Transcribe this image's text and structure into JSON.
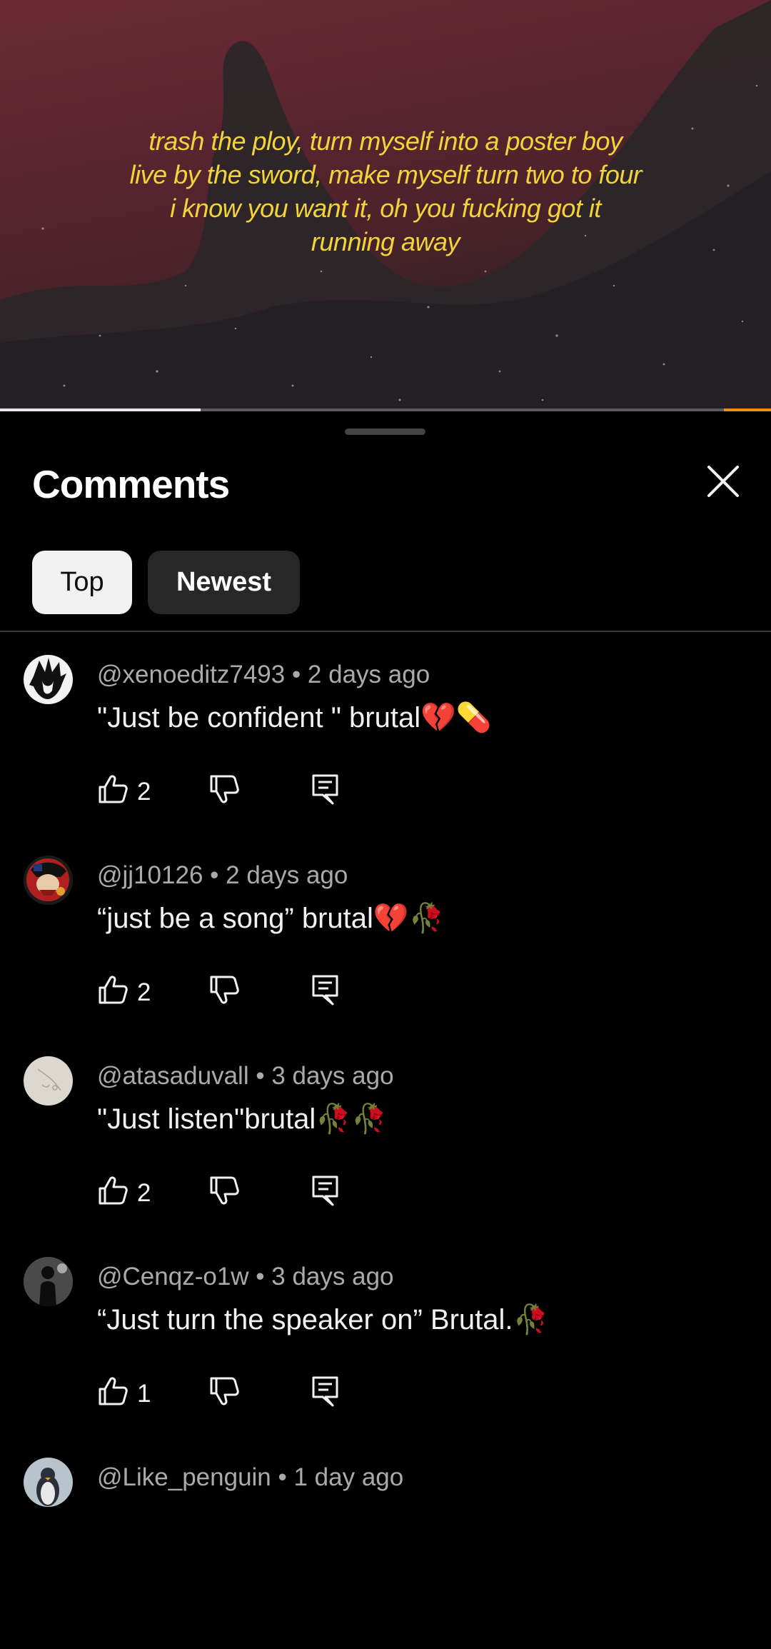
{
  "video": {
    "lyrics": [
      "trash the ploy, turn myself into a poster boy",
      "live by the sword, make myself turn two to four",
      "i know you want it, oh you fucking got it",
      "running away"
    ],
    "progress_fraction": 0.26
  },
  "comments_sheet": {
    "title": "Comments",
    "filters": [
      {
        "label": "Top",
        "selected": true
      },
      {
        "label": "Newest",
        "selected": false
      }
    ]
  },
  "comments": [
    {
      "author": "@xenoeditz7493",
      "time": "2 days ago",
      "text": "\"Just be confident \" brutal",
      "emoji": "💔💊",
      "likes": "2"
    },
    {
      "author": "@jj10126",
      "time": "2 days ago",
      "text": "“just be a song” brutal",
      "emoji": "💔🥀",
      "likes": "2"
    },
    {
      "author": "@atasaduvall",
      "time": "3 days ago",
      "text": "\"Just listen\"brutal",
      "emoji": "🥀🥀",
      "likes": "2"
    },
    {
      "author": "@Cenqz-o1w",
      "time": "3 days ago",
      "text": "“Just turn the speaker on” Brutal.",
      "emoji": "🥀",
      "likes": "1"
    },
    {
      "author": "@Like_penguin",
      "time": "1 day ago",
      "text": "",
      "emoji": "",
      "likes": ""
    }
  ],
  "separator": " • ",
  "colors": {
    "lyrics": "#f2d33a",
    "progress_accent": "#e9921a",
    "sheet_bg": "#000000",
    "meta_text": "#aaaaaa"
  },
  "icons": {
    "like": "thumbs-up-icon",
    "dislike": "thumbs-down-icon",
    "reply": "reply-comment-icon",
    "close": "close-icon"
  }
}
